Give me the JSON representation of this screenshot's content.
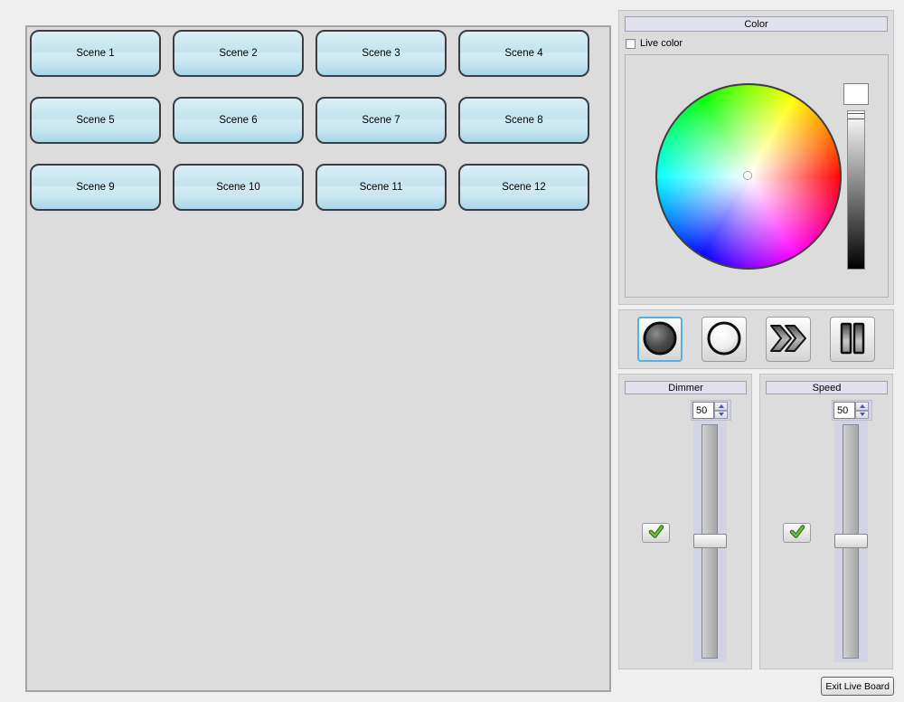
{
  "scenes": {
    "labels": [
      "Scene 1",
      "Scene 2",
      "Scene 3",
      "Scene 4",
      "Scene 5",
      "Scene 6",
      "Scene 7",
      "Scene 8",
      "Scene 9",
      "Scene 10",
      "Scene 11",
      "Scene 12"
    ]
  },
  "color": {
    "title": "Color",
    "live_color_label": "Live color",
    "live_color_checked": false,
    "selected_color": "#ffffff",
    "value_slider_position": "top"
  },
  "playback": {
    "selected_index": 0,
    "modes": [
      "blackout",
      "full-on",
      "fast-forward",
      "pause"
    ]
  },
  "dimmer": {
    "title": "Dimmer",
    "value": "50",
    "enabled": true
  },
  "speed": {
    "title": "Speed",
    "value": "50",
    "enabled": true
  },
  "exit": {
    "label": "Exit Live Board"
  },
  "theme": {
    "panel_bg": "#dcdcdc",
    "header_bg": "#e0e1ec",
    "scene_button_top": "#daeff6",
    "scene_button_bottom": "#a9d6e7",
    "selected_border": "#56b0e0",
    "check_green": "#55b32c"
  }
}
